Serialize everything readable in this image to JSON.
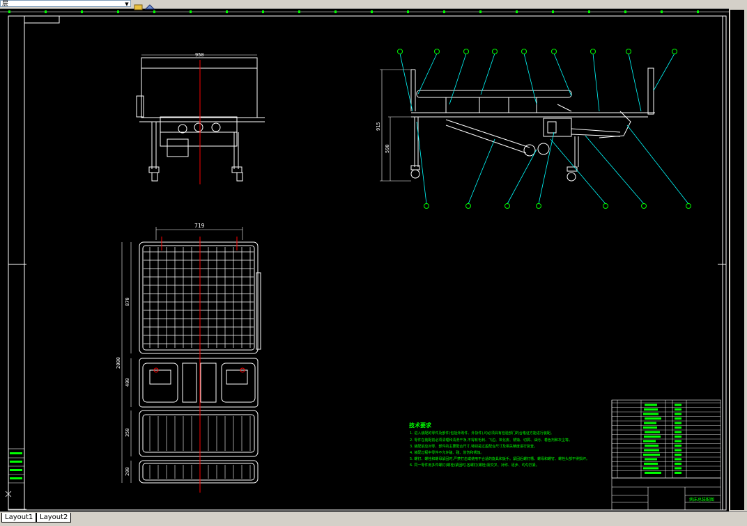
{
  "toolbar": {
    "layer_value": "层",
    "layer_arrow_icon": "chevron-down-icon"
  },
  "tabs": [
    {
      "label": "Layout1"
    },
    {
      "label": "Layout2"
    }
  ],
  "dimensions": {
    "front_width": "950",
    "plan_width": "719",
    "side_height_total": "915",
    "side_height_partial": "590",
    "plan_total_length": "2000",
    "plan_seg1": "870",
    "plan_seg2": "400",
    "plan_seg3": "350",
    "plan_seg4": "200"
  },
  "notes": {
    "title": "技术要求",
    "lines": [
      "1. 进入装配的零件及部件(包括外购件、外协件),均必须具有检验部门的合格证方能进行装配。",
      "2. 零件在装配前必须清理和清洗干净,不得有毛刺、飞边、氧化皮、锈蚀、切屑、油污、着色剂和灰尘等。",
      "3. 装配前应对零、部件的主要配合尺寸,特别是过盈配合尺寸及相关精度进行复查。",
      "4. 装配过程中零件不允许磕、碰、划伤和锈蚀。",
      "5. 螺钉、螺栓和螺母紧固时,严禁打击或使用不合适的旋具和扳手。紧固后螺钉槽、螺母和螺钉、螺栓头部不得损坏。",
      "6. 同一零件用多件螺钉(螺栓)紧固时,各螺钉(螺栓)需交叉、对称、逐步、均匀拧紧。"
    ]
  },
  "title_block": {
    "drawing_name": "病床总装配图"
  },
  "colors": {
    "background": "#000000",
    "lines": "#ffffff",
    "leaders": "#00ffff",
    "text": "#00ff00",
    "centerline": "#ff0000"
  }
}
